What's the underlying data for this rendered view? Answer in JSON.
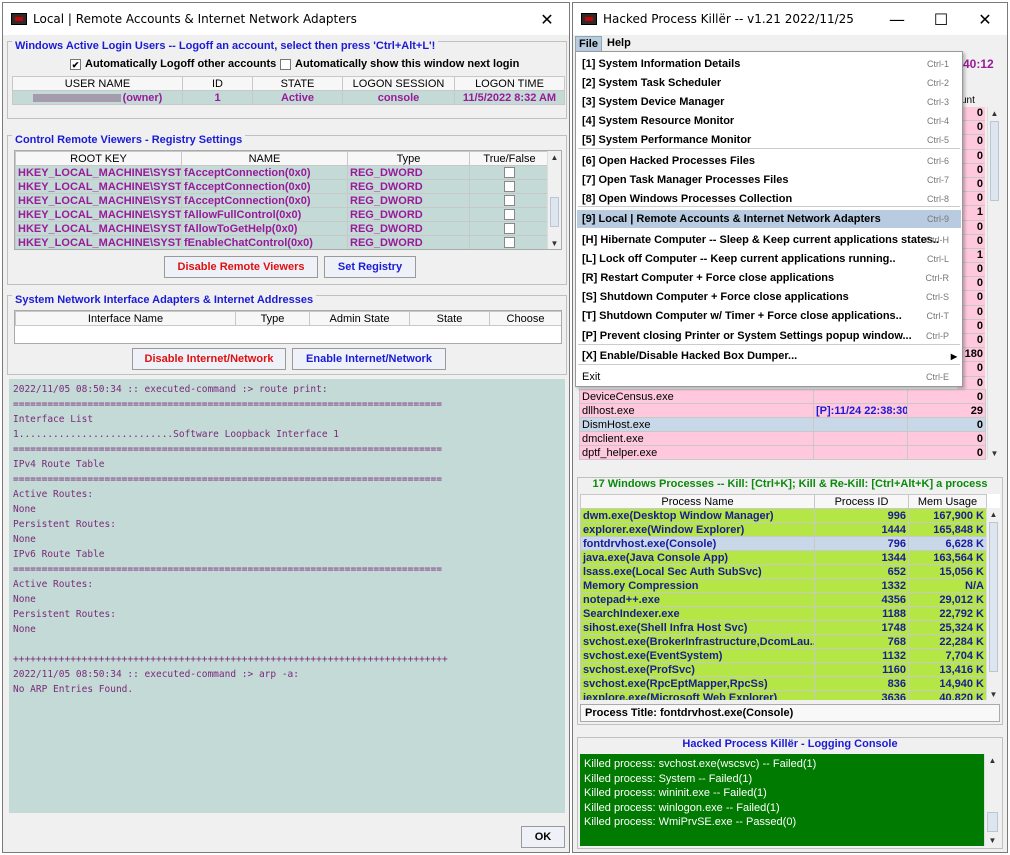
{
  "left": {
    "title": "Local | Remote Accounts & Internet Network Adapters",
    "sessions": {
      "title": "Windows Active Login Users -- Logoff an account, select then press 'Ctrl+Alt+L'!",
      "chk1": "Automatically Logoff other accounts",
      "chk2": "Automatically show this window next login",
      "cols": [
        "USER NAME",
        "ID",
        "STATE",
        "LOGON SESSION",
        "LOGON TIME"
      ],
      "row": [
        "(owner)",
        "1",
        "Active",
        "console",
        "11/5/2022 8:32 AM"
      ]
    },
    "registry": {
      "title": "Control Remote Viewers - Registry Settings",
      "cols": [
        "ROOT KEY",
        "NAME",
        "Type",
        "True/False"
      ],
      "rows": [
        [
          "HKEY_LOCAL_MACHINE\\SYSTE...",
          "fAcceptConnection(0x0)",
          "REG_DWORD"
        ],
        [
          "HKEY_LOCAL_MACHINE\\SYSTE...",
          "fAcceptConnection(0x0)",
          "REG_DWORD"
        ],
        [
          "HKEY_LOCAL_MACHINE\\SYSTE...",
          "fAcceptConnection(0x0)",
          "REG_DWORD"
        ],
        [
          "HKEY_LOCAL_MACHINE\\SYSTE...",
          "fAllowFullControl(0x0)",
          "REG_DWORD"
        ],
        [
          "HKEY_LOCAL_MACHINE\\SYSTE...",
          "fAllowToGetHelp(0x0)",
          "REG_DWORD"
        ],
        [
          "HKEY_LOCAL_MACHINE\\SYSTE...",
          "fEnableChatControl(0x0)",
          "REG_DWORD"
        ]
      ],
      "btn_disable": "Disable Remote Viewers",
      "btn_set": "Set Registry"
    },
    "network": {
      "title": "System Network Interface Adapters & Internet Addresses",
      "cols": [
        "Interface Name",
        "Type",
        "Admin State",
        "State",
        "Choose"
      ],
      "btn_disable": "Disable Internet/Network",
      "btn_enable": "Enable Internet/Network"
    },
    "console": "2022/11/05 08:50:34 :: executed-command :> route print:\n===========================================================================\nInterface List\n1...........................Software Loopback Interface 1\n===========================================================================\nIPv4 Route Table\n===========================================================================\nActive Routes:\nNone\nPersistent Routes:\nNone\nIPv6 Route Table\n===========================================================================\nActive Routes:\nNone\nPersistent Routes:\nNone\n\n++++++++++++++++++++++++++++++++++++++++++++++++++++++++++++++++++++++++++++\n2022/11/05 08:50:34 :: executed-command :> arp -a:\nNo ARP Entries Found.",
    "ok": "OK"
  },
  "right": {
    "title": "Hacked Process Killër -- v1.21 2022/11/25",
    "menubar": [
      "File",
      "Help"
    ],
    "timefrag": "40:12",
    "colfrag": "unt",
    "menu": [
      {
        "k": "1",
        "t": "System Information Details",
        "a": "Ctrl-1"
      },
      {
        "k": "2",
        "t": "System Task Scheduler",
        "a": "Ctrl-2"
      },
      {
        "k": "3",
        "t": "System Device Manager",
        "a": "Ctrl-3"
      },
      {
        "k": "4",
        "t": "System Resource Monitor",
        "a": "Ctrl-4"
      },
      {
        "k": "5",
        "t": "System Performance Monitor",
        "a": "Ctrl-5"
      },
      {
        "k": "6",
        "t": "Open Hacked Processes Files",
        "a": "Ctrl-6"
      },
      {
        "k": "7",
        "t": "Open Task Manager Processes Files",
        "a": "Ctrl-7"
      },
      {
        "k": "8",
        "t": "Open Windows Processes Collection",
        "a": "Ctrl-8"
      },
      {
        "k": "9",
        "t": "Local | Remote Accounts & Internet Network Adapters",
        "a": "Ctrl-9"
      },
      {
        "k": "H",
        "t": "Hibernate Computer -- Sleep & Keep current applications states..",
        "a": "Ctrl-H"
      },
      {
        "k": "L",
        "t": "Lock off Computer -- Keep current applications running..",
        "a": "Ctrl-L"
      },
      {
        "k": "R",
        "t": "Restart Computer + Force close applications",
        "a": "Ctrl-R"
      },
      {
        "k": "S",
        "t": "Shutdown Computer + Force close applications",
        "a": "Ctrl-S"
      },
      {
        "k": "T",
        "t": "Shutdown Computer w/ Timer + Force close applications..",
        "a": "Ctrl-T"
      },
      {
        "k": "P",
        "t": "Prevent closing Printer or System Settings popup window...",
        "a": "Ctrl-P"
      },
      {
        "k": "X",
        "t": "Enable/Disable Hacked Box Dumper...",
        "a": ""
      },
      {
        "k": "",
        "t": "Exit",
        "a": "Ctrl-E"
      }
    ],
    "counts_visible": [
      "0",
      "0",
      "0",
      "0",
      "0",
      "0",
      "0",
      "1",
      "0",
      "0",
      "1",
      "0",
      "0",
      "0",
      "0",
      "0",
      "0",
      "180",
      "0",
      "0"
    ],
    "hacked_rows": [
      {
        "name": "DeviceCensus.exe",
        "time": "",
        "count": "0",
        "bg": "#ffc8dc"
      },
      {
        "name": "dllhost.exe",
        "time": "[P]:11/24 22:38:30",
        "count": "29",
        "bg": "#ffc8dc"
      },
      {
        "name": "DismHost.exe",
        "time": "",
        "count": "0",
        "bg": "#c8d8e8"
      },
      {
        "name": "dmclient.exe",
        "time": "",
        "count": "0",
        "bg": "#ffc8dc"
      },
      {
        "name": "dptf_helper.exe",
        "time": "",
        "count": "0",
        "bg": "#ffc8dc"
      }
    ],
    "winproc": {
      "title": "17 Windows Processes -- Kill: [Ctrl+K]; Kill & Re-Kill: [Ctrl+Alt+K] a process",
      "cols": [
        "Process Name",
        "Process ID",
        "Mem Usage"
      ],
      "rows": [
        [
          "dwm.exe(Desktop Window Manager)",
          "996",
          "167,900 K"
        ],
        [
          "explorer.exe(Window Explorer)",
          "1444",
          "165,848 K"
        ],
        [
          "fontdrvhost.exe(Console)",
          "796",
          "6,628 K"
        ],
        [
          "java.exe(Java Console App)",
          "1344",
          "163,564 K"
        ],
        [
          "lsass.exe(Local Sec Auth SubSvc)",
          "652",
          "15,056 K"
        ],
        [
          "Memory Compression",
          "1332",
          "N/A"
        ],
        [
          "notepad++.exe",
          "4356",
          "29,012 K"
        ],
        [
          "SearchIndexer.exe",
          "1188",
          "22,792 K"
        ],
        [
          "sihost.exe(Shell Infra Host Svc)",
          "1748",
          "25,324 K"
        ],
        [
          "svchost.exe(BrokerInfrastructure,DcomLau...",
          "768",
          "22,284 K"
        ],
        [
          "svchost.exe(EventSystem)",
          "1132",
          "7,704 K"
        ],
        [
          "svchost.exe(ProfSvc)",
          "1160",
          "13,416 K"
        ],
        [
          "svchost.exe(RpcEptMapper,RpcSs)",
          "836",
          "14,940 K"
        ],
        [
          "iexplore.exe(Microsoft Web Explorer)",
          "3636",
          "40,820 K"
        ]
      ],
      "selected_index": 2,
      "status": "Process Title: fontdrvhost.exe(Console)"
    },
    "log": {
      "title": "Hacked Process Killër - Logging Console",
      "lines": [
        "Killed process: svchost.exe(wscsvc) -- Failed(1)",
        "Killed process: System -- Failed(1)",
        "Killed process: wininit.exe -- Failed(1)",
        "Killed process: winlogon.exe -- Failed(1)",
        "Killed process: WmiPrvSE.exe -- Passed(0)"
      ]
    }
  }
}
